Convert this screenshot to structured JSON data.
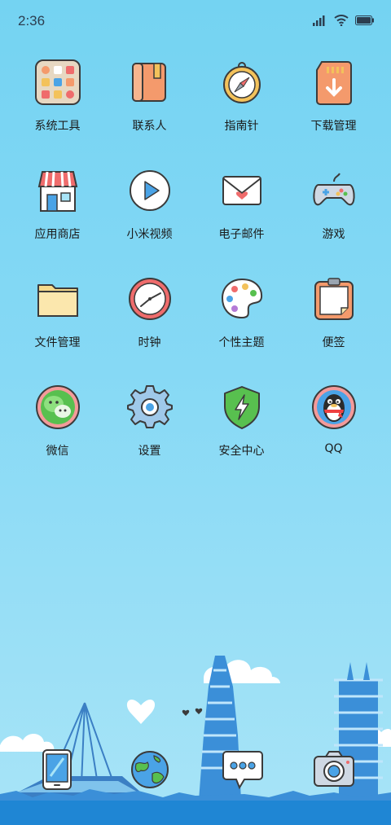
{
  "status_bar": {
    "time": "2:36"
  },
  "apps": [
    [
      {
        "label": "系统工具",
        "icon": "tools-folder-icon"
      },
      {
        "label": "联系人",
        "icon": "contacts-book-icon"
      },
      {
        "label": "指南针",
        "icon": "compass-icon"
      },
      {
        "label": "下载管理",
        "icon": "download-card-icon"
      }
    ],
    [
      {
        "label": "应用商店",
        "icon": "shop-icon"
      },
      {
        "label": "小米视频",
        "icon": "video-play-icon"
      },
      {
        "label": "电子邮件",
        "icon": "mail-envelope-icon"
      },
      {
        "label": "游戏",
        "icon": "gamepad-icon"
      }
    ],
    [
      {
        "label": "文件管理",
        "icon": "folder-icon"
      },
      {
        "label": "时钟",
        "icon": "clock-icon"
      },
      {
        "label": "个性主题",
        "icon": "palette-icon"
      },
      {
        "label": "便签",
        "icon": "notepad-icon"
      }
    ],
    [
      {
        "label": "微信",
        "icon": "wechat-icon"
      },
      {
        "label": "设置",
        "icon": "gear-icon"
      },
      {
        "label": "安全中心",
        "icon": "shield-icon"
      },
      {
        "label": "QQ",
        "icon": "penguin-icon"
      }
    ]
  ],
  "dock": [
    {
      "icon": "phone-icon"
    },
    {
      "icon": "globe-icon"
    },
    {
      "icon": "chat-bubble-icon"
    },
    {
      "icon": "camera-icon"
    }
  ],
  "colors": {
    "sky": "#7fd6f4",
    "outline": "#3b3b3b",
    "orange": "#f49a6c",
    "red": "#ef6c6c",
    "blue": "#4aa3e6",
    "green": "#58c04f"
  }
}
